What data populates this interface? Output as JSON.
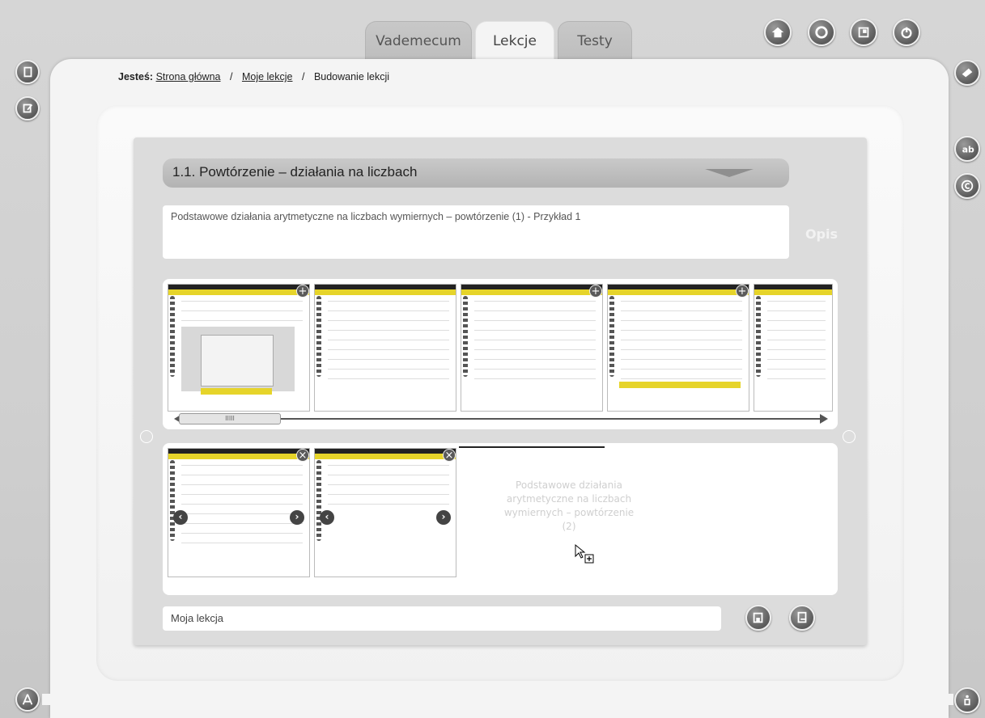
{
  "tabs": [
    {
      "label": "Vademecum",
      "active": false
    },
    {
      "label": "Lekcje",
      "active": true
    },
    {
      "label": "Testy",
      "active": false
    }
  ],
  "breadcrumb": {
    "prefix": "Jesteś:",
    "items": [
      "Strona główna",
      "Moje lekcje",
      "Budowanie lekcji"
    ],
    "separator": "/"
  },
  "lesson": {
    "title": "1.1. Powtórzenie – działania na liczbach",
    "description": "Podstawowe działania arytmetyczne na liczbach wymiernych – powtórzenie (1) - Przykład 1",
    "description_label": "Opis"
  },
  "scrollbar": {
    "thumb_label": "IIIII"
  },
  "drop_hint": "Podstawowe działania arytmetyczne na liczbach wymiernych – powtórzenie (2)",
  "lesson_name": {
    "value": "Moja lekcja"
  },
  "colors": {
    "accent": "#e6d42a",
    "dark": "#4a4a4a",
    "panel": "#dcdcdc"
  }
}
